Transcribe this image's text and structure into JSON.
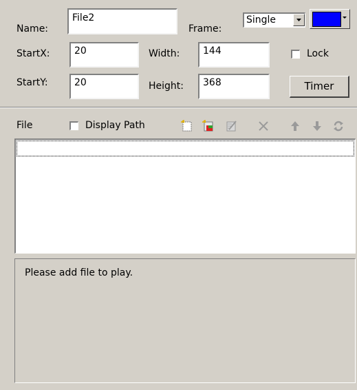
{
  "props": {
    "name_label": "Name:",
    "name_value": "File2",
    "frame_label": "Frame:",
    "frame_value": "Single",
    "color": "#0000ff",
    "startx_label": "StartX:",
    "startx_value": "20",
    "width_label": "Width:",
    "width_value": "144",
    "lock_label": "Lock",
    "starty_label": "StartY:",
    "starty_value": "20",
    "height_label": "Height:",
    "height_value": "368",
    "timer_label": "Timer"
  },
  "files": {
    "label": "File",
    "display_path_label": "Display Path",
    "toolbar_icons": [
      "new-file-icon",
      "add-file-icon",
      "edit-icon",
      "delete-icon",
      "move-up-icon",
      "move-down-icon",
      "refresh-icon"
    ]
  },
  "message": {
    "text": "Please add file to play."
  }
}
